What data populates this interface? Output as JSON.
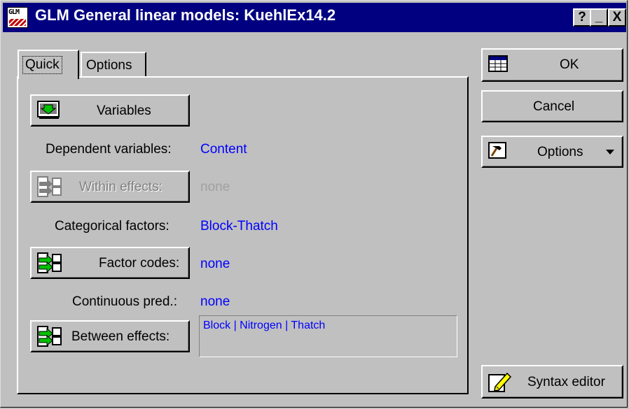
{
  "window": {
    "app_icon_text": "GLM",
    "title": "GLM General linear models: KuehlEx14.2",
    "help_button": "?",
    "minimize_button": "_",
    "close_button": "X"
  },
  "tabs": [
    {
      "label": "Quick",
      "active": true
    },
    {
      "label": "Options",
      "active": false
    }
  ],
  "quick": {
    "variables_button": "Variables",
    "dependent_label": "Dependent variables:",
    "dependent_value": "Content",
    "within_button": "Within effects:",
    "within_value": "none",
    "categorical_label": "Categorical factors:",
    "categorical_value": "Block-Thatch",
    "factor_codes_button": "Factor codes:",
    "factor_codes_value": "none",
    "continuous_label": "Continuous pred.:",
    "continuous_value": "none",
    "between_button": "Between effects:",
    "between_value": "Block | Nitrogen | Thatch"
  },
  "side": {
    "ok": "OK",
    "cancel": "Cancel",
    "options": "Options",
    "syntax_editor": "Syntax editor"
  },
  "icons": {
    "variables": "variables-icon",
    "effects": "effects-icon",
    "ok": "spreadsheet-icon",
    "options": "hammer-icon",
    "syntax": "pencil-note-icon",
    "dropdown": "triangle-down-icon"
  },
  "colors": {
    "titlebar": "#000080",
    "face": "#c0c0c0",
    "value_text": "#0000ff",
    "disabled_text": "#a0a0a0"
  }
}
